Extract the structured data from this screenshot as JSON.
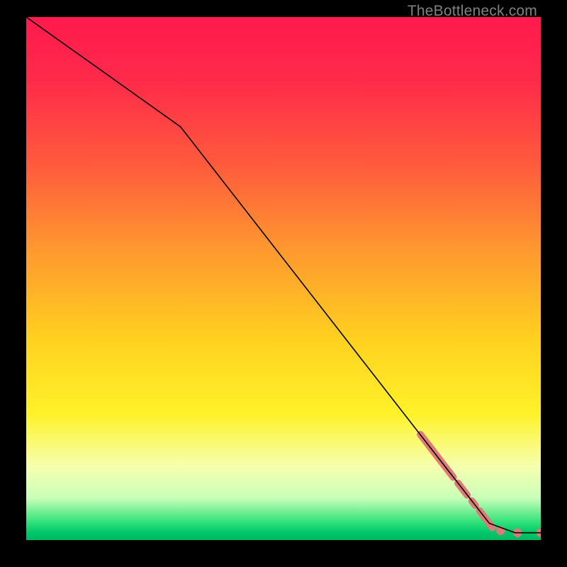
{
  "watermark": "TheBottleneck.com",
  "chart_data": {
    "type": "line",
    "title": "",
    "xlabel": "",
    "ylabel": "",
    "xlim": [
      0,
      100
    ],
    "ylim": [
      0,
      100
    ],
    "background_gradient_stops": [
      {
        "offset": 0.0,
        "color": "#ff1a4d"
      },
      {
        "offset": 0.12,
        "color": "#ff2a4a"
      },
      {
        "offset": 0.28,
        "color": "#ff5a3d"
      },
      {
        "offset": 0.45,
        "color": "#ff9a2f"
      },
      {
        "offset": 0.62,
        "color": "#ffd21f"
      },
      {
        "offset": 0.76,
        "color": "#fff22a"
      },
      {
        "offset": 0.86,
        "color": "#f6ffb0"
      },
      {
        "offset": 0.92,
        "color": "#c8ffb8"
      },
      {
        "offset": 0.965,
        "color": "#33e27a"
      },
      {
        "offset": 0.985,
        "color": "#00c86a"
      },
      {
        "offset": 1.0,
        "color": "#00b860"
      }
    ],
    "series": [
      {
        "name": "curve",
        "color": "#000000",
        "width": 1.6,
        "points": [
          {
            "x": 0,
            "y": 100
          },
          {
            "x": 30,
            "y": 79
          },
          {
            "x": 90,
            "y": 3.2
          },
          {
            "x": 95,
            "y": 1.4
          },
          {
            "x": 100,
            "y": 1.4
          }
        ]
      }
    ],
    "thick_segments": {
      "color": "#e07a77",
      "width": 10,
      "cap": "round",
      "segments": [
        {
          "x1": 76.6,
          "y1": 20.2,
          "x2": 83.0,
          "y2": 12.0
        },
        {
          "x1": 83.9,
          "y1": 10.9,
          "x2": 85.7,
          "y2": 8.6
        },
        {
          "x1": 86.6,
          "y1": 7.5,
          "x2": 87.3,
          "y2": 6.6
        },
        {
          "x1": 88.1,
          "y1": 5.6,
          "x2": 90.6,
          "y2": 2.4
        }
      ]
    },
    "dots": {
      "color": "#e07a77",
      "radius": 6.2,
      "points": [
        {
          "x": 92.2,
          "y": 1.8
        },
        {
          "x": 95.5,
          "y": 1.4
        },
        {
          "x": 100,
          "y": 1.4
        }
      ]
    }
  }
}
